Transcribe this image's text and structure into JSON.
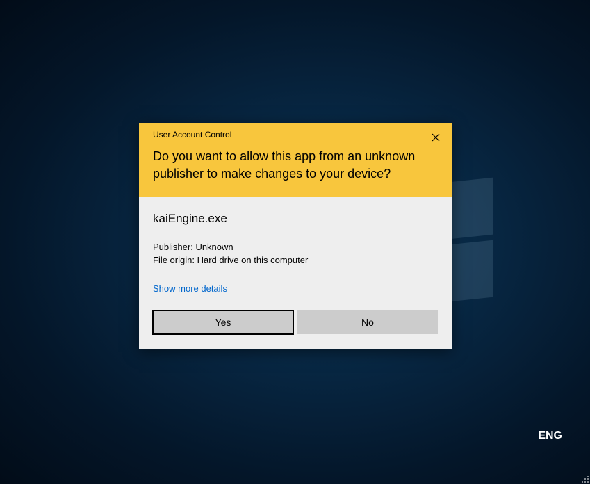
{
  "dialog": {
    "title": "User Account Control",
    "question": "Do you want to allow this app from an unknown publisher to make changes to your device?",
    "app_name": "kaiEngine.exe",
    "publisher_label": "Publisher:",
    "publisher_value": "Unknown",
    "origin_label": "File origin:",
    "origin_value": "Hard drive on this computer",
    "details_link": "Show more details",
    "yes_label": "Yes",
    "no_label": "No"
  },
  "taskbar": {
    "language": "ENG"
  }
}
